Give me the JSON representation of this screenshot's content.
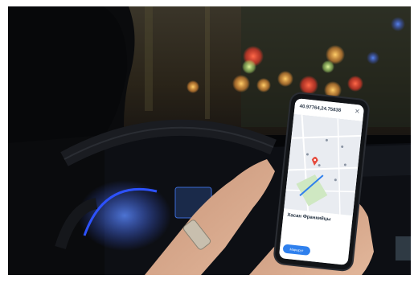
{
  "scene": {
    "colors": {
      "background": "#050608",
      "bokeh_warm": "#ff9d3a",
      "bokeh_red": "#ff3b2b",
      "bokeh_green": "#a6d86a",
      "dashboard_glow": "#3a5cff",
      "skin": "#e2b79b"
    }
  },
  "phone": {
    "coordinates": "40.97764,24.75838",
    "close_icon": "close-icon",
    "map": {
      "accent": "#e64a3c",
      "route_color": "#2f80ed"
    },
    "place_title": "Хасан Франкийцы",
    "place_subtitle": "",
    "actions": {
      "route_label": "Маршрут",
      "save_label": "",
      "share_label": ""
    }
  }
}
